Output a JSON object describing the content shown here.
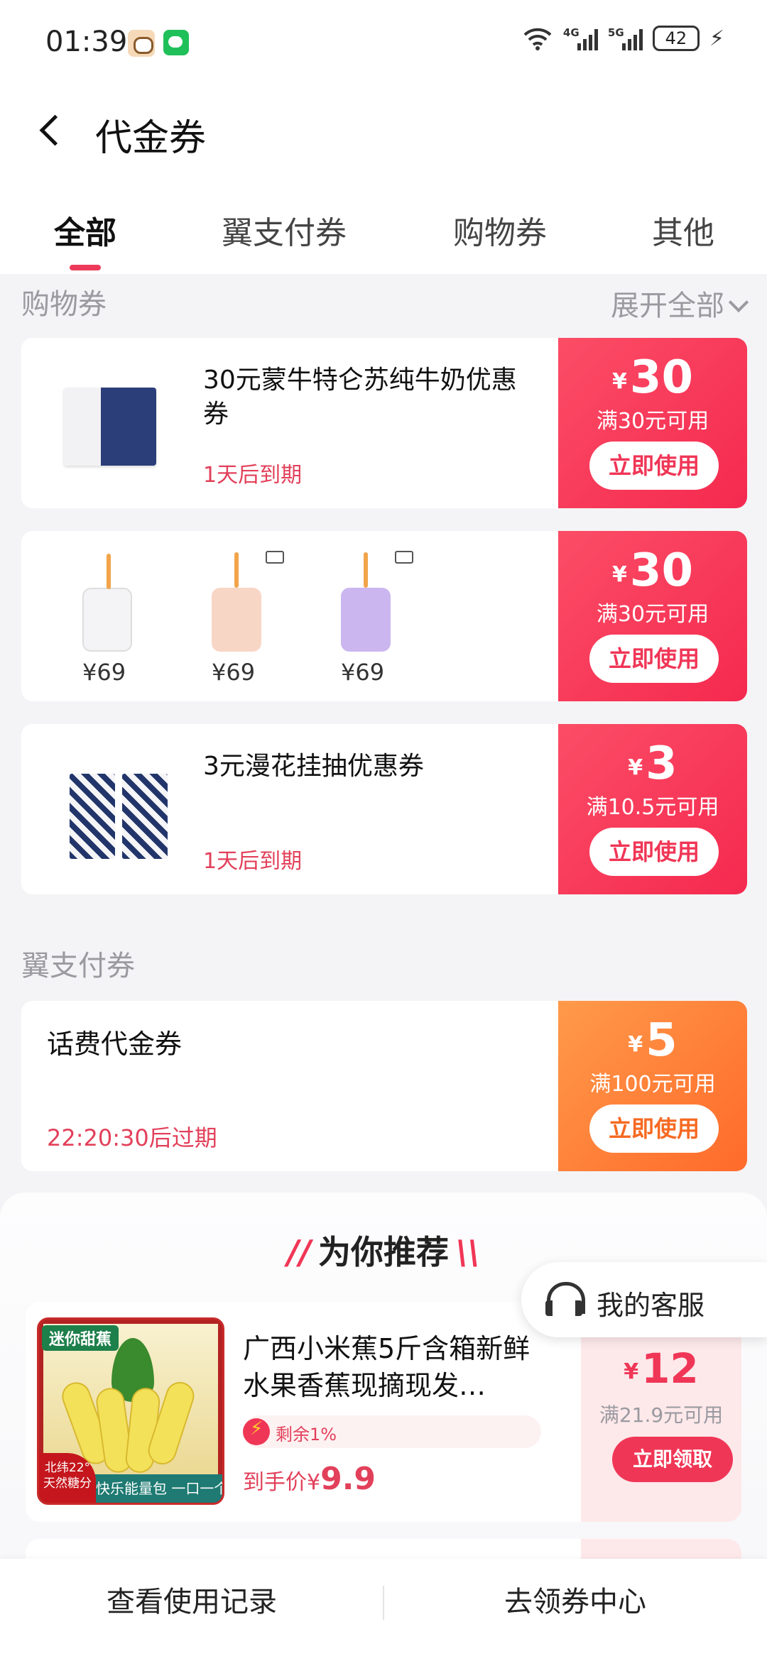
{
  "status_bar": {
    "time": "01:39",
    "signal1": "4G",
    "signal2": "5G",
    "battery": "42"
  },
  "header": {
    "title": "代金券"
  },
  "tabs": [
    {
      "label": "全部",
      "active": true
    },
    {
      "label": "翼支付券",
      "active": false
    },
    {
      "label": "购物券",
      "active": false
    },
    {
      "label": "其他",
      "active": false
    }
  ],
  "shopping_section": {
    "title": "购物券",
    "expand_label": "展开全部",
    "coupons": [
      {
        "title": "30元蒙牛特仑苏纯牛奶优惠券",
        "expire": "1天后到期",
        "currency": "¥",
        "amount": "30",
        "threshold": "满30元可用",
        "button": "立即使用"
      },
      {
        "products": [
          {
            "price": "¥69"
          },
          {
            "price": "¥69"
          },
          {
            "price": "¥69"
          }
        ],
        "currency": "¥",
        "amount": "30",
        "threshold": "满30元可用",
        "button": "立即使用"
      },
      {
        "title": "3元漫花挂抽优惠券",
        "expire": "1天后到期",
        "currency": "¥",
        "amount": "3",
        "threshold": "满10.5元可用",
        "button": "立即使用"
      }
    ]
  },
  "yipay_section": {
    "title": "翼支付券",
    "coupons": [
      {
        "title": "话费代金券",
        "expire": "22:20:30后过期",
        "currency": "¥",
        "amount": "5",
        "threshold": "满100元可用",
        "button": "立即使用"
      }
    ]
  },
  "recommend": {
    "title": "为你推荐",
    "items": [
      {
        "name": "广西小米蕉5斤含箱新鲜水果香蕉现摘现发…",
        "image_tag": "迷你甜蕉",
        "image_badge": "北纬22°天然糖分",
        "image_band": "快乐能量包 一口一个",
        "stock": "剩余1%",
        "final_price_label": "到手价",
        "final_price_currency": "¥",
        "final_price": "9.9",
        "currency": "¥",
        "amount": "12",
        "threshold": "满21.9元可用",
        "button": "立即领取"
      }
    ]
  },
  "customer_service": {
    "label": "我的客服"
  },
  "bottom_bar": {
    "left": "查看使用记录",
    "right": "去领券中心"
  },
  "colors": {
    "accent": "#f03656",
    "coupon_red": "#f5294f",
    "coupon_orange": "#ff6a2a"
  }
}
